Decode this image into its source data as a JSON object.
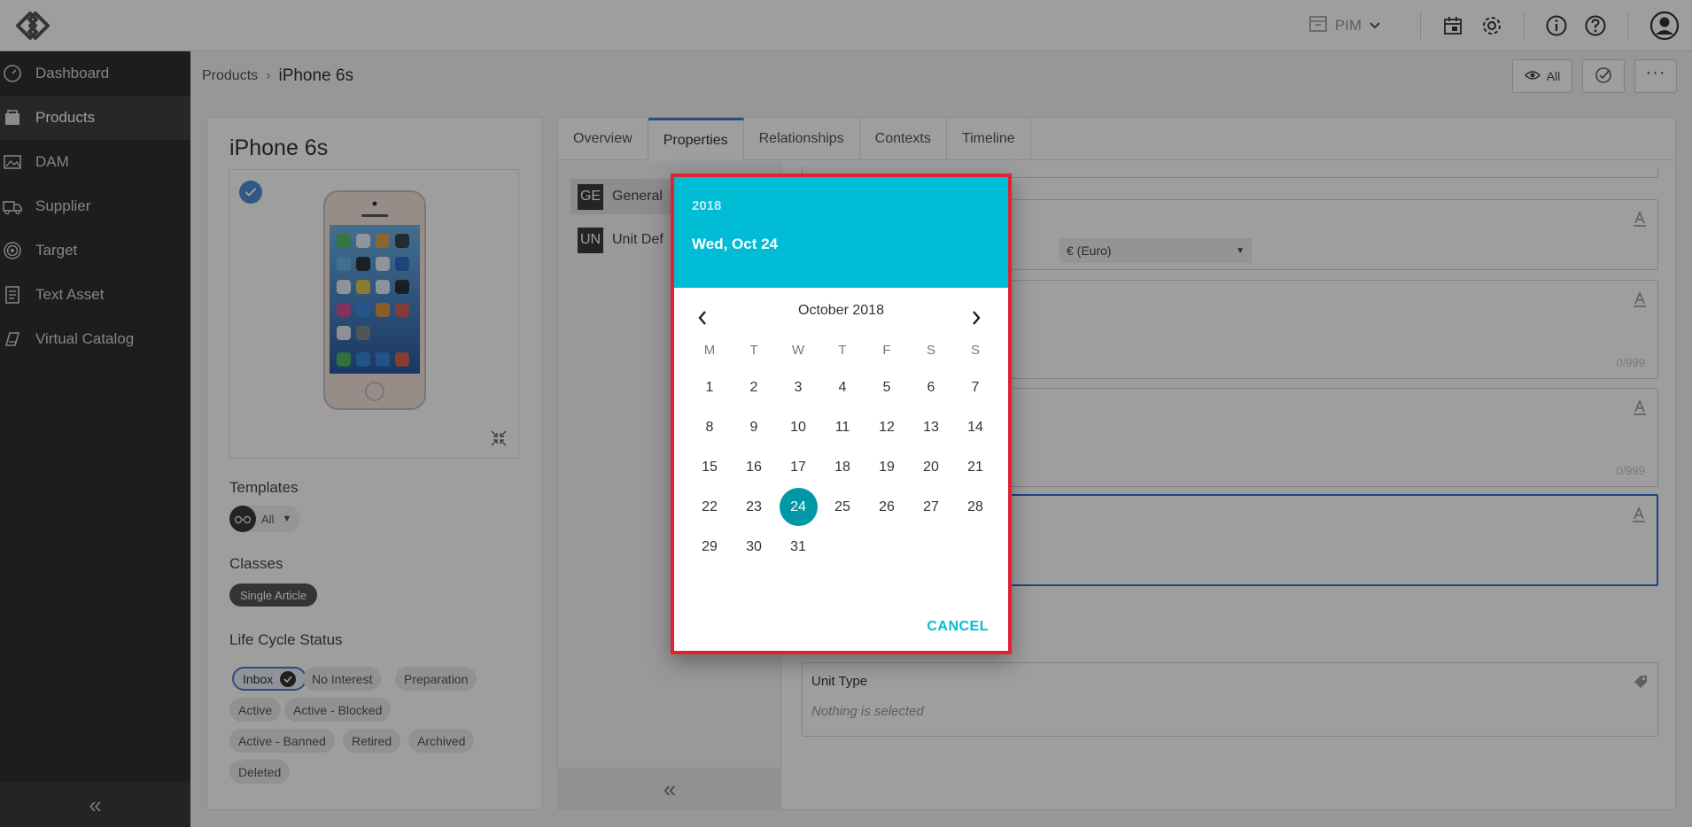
{
  "pim": {
    "label": "PIM"
  },
  "sidebar": {
    "items": [
      {
        "label": "Dashboard",
        "icon": "dashboard-icon"
      },
      {
        "label": "Products",
        "icon": "products-icon"
      },
      {
        "label": "DAM",
        "icon": "image-icon"
      },
      {
        "label": "Supplier",
        "icon": "truck-icon"
      },
      {
        "label": "Target",
        "icon": "target-icon"
      },
      {
        "label": "Text Asset",
        "icon": "document-icon"
      },
      {
        "label": "Virtual Catalog",
        "icon": "catalog-icon"
      }
    ],
    "active_index": 1
  },
  "breadcrumb": {
    "parent": "Products",
    "separator": "›",
    "current": "iPhone 6s"
  },
  "subheader": {
    "view_all_label": "All"
  },
  "product": {
    "title": "iPhone 6s",
    "templates_label": "Templates",
    "templates_value": "All",
    "classes_label": "Classes",
    "class_value": "Single Article",
    "lifecycle_label": "Life Cycle Status",
    "statuses": [
      "Inbox",
      "No Interest",
      "Preparation",
      "Active",
      "Active - Blocked",
      "Active - Banned",
      "Retired",
      "Archived",
      "Deleted"
    ],
    "selected_status": "Inbox"
  },
  "tabs": [
    "Overview",
    "Properties",
    "Relationships",
    "Contexts",
    "Timeline"
  ],
  "active_tab": "Properties",
  "groups": [
    {
      "abbr": "GE",
      "label": "General"
    },
    {
      "abbr": "UN",
      "label": "Unit Def"
    }
  ],
  "fields": {
    "currency_value": "€ (Euro)",
    "counter_1": "0/999",
    "counter_2": "0/999",
    "unit_type_label": "Unit Type",
    "unit_type_placeholder": "Nothing is selected"
  },
  "datepicker": {
    "year": "2018",
    "selected_long": "Wed, Oct 24",
    "month_label": "October 2018",
    "weekdays": [
      "M",
      "T",
      "W",
      "T",
      "F",
      "S",
      "S"
    ],
    "weeks": [
      [
        "1",
        "2",
        "3",
        "4",
        "5",
        "6",
        "7"
      ],
      [
        "8",
        "9",
        "10",
        "11",
        "12",
        "13",
        "14"
      ],
      [
        "15",
        "16",
        "17",
        "18",
        "19",
        "20",
        "21"
      ],
      [
        "22",
        "23",
        "24",
        "25",
        "26",
        "27",
        "28"
      ],
      [
        "29",
        "30",
        "31",
        "",
        "",
        "",
        ""
      ]
    ],
    "selected_day": "24",
    "cancel_label": "CANCEL",
    "accent_color": "#00bcd4",
    "selected_color": "#0097a7",
    "border_color": "#e02232"
  }
}
